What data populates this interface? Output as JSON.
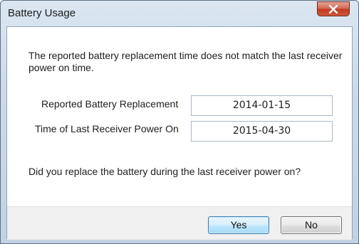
{
  "window": {
    "title": "Battery Usage",
    "close_icon": "close-x-icon"
  },
  "dialog": {
    "message": "The reported battery replacement time does not match the last receiver power on time.",
    "fields": [
      {
        "label": "Reported Battery Replacement",
        "value": "2014-01-15"
      },
      {
        "label": "Time of Last Receiver Power On",
        "value": "2015-04-30"
      }
    ],
    "question": "Did you replace the battery during the last receiver power on?"
  },
  "buttons": {
    "yes": "Yes",
    "no": "No"
  },
  "colors": {
    "close_button": "#c23a22",
    "default_button_border": "#3c7fb1",
    "title_bar": "#cbd9e8"
  }
}
